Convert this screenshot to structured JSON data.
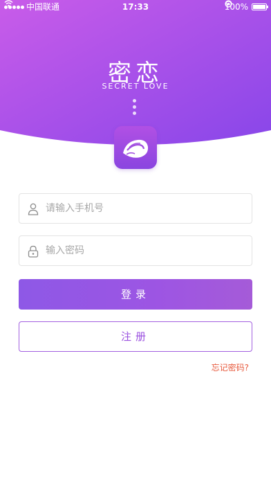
{
  "status_bar": {
    "carrier": "中国联通",
    "time": "17:33",
    "battery": "100%",
    "battery_level": 1.0
  },
  "brand": {
    "title": "密恋",
    "subtitle": "SECRET LOVE"
  },
  "colors": {
    "header_gradient_start": "#c55ae9",
    "header_gradient_end": "#8a47e8",
    "accent": "#9a4fdf",
    "forgot_link": "#e7593c"
  },
  "form": {
    "phone_placeholder": "请输入手机号",
    "password_placeholder": "输入密码",
    "login_label": "登录",
    "register_label": "注册",
    "forgot_label": "忘记密码?"
  }
}
